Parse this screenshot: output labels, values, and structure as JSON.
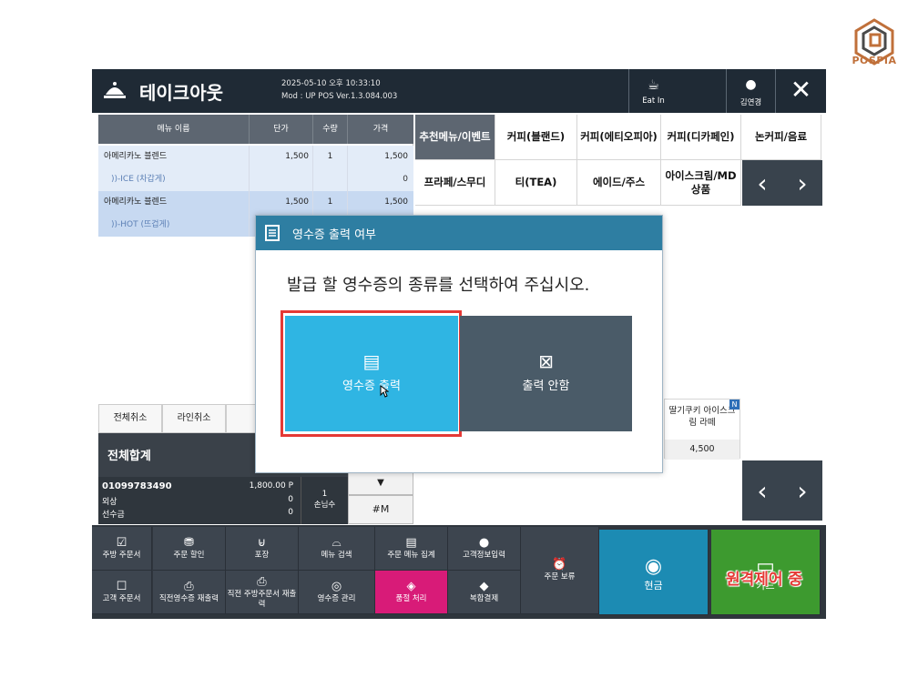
{
  "brand": {
    "name": "POSPIA"
  },
  "header": {
    "title": "테이크아웃",
    "datetime": "2025-05-10 오후 10:33:10",
    "mod": "Mod : UP POS Ver.1.3.084.003",
    "eat_in": "Eat In",
    "user": "김연경"
  },
  "order": {
    "columns": [
      "메뉴 이름",
      "단가",
      "수량",
      "가격"
    ],
    "rows": [
      {
        "name": "아메리카노 블렌드",
        "price": "1,500",
        "qty": "1",
        "total": "1,500"
      },
      {
        "name": "))-ICE (차갑게)",
        "price": "",
        "qty": "",
        "total": "0"
      },
      {
        "name": "아메리카노 블렌드",
        "price": "1,500",
        "qty": "1",
        "total": "1,500"
      },
      {
        "name": "))-HOT (뜨겁게)",
        "price": "",
        "qty": "",
        "total": ""
      }
    ],
    "cancel_all": "전체취소",
    "cancel_line": "라인취소",
    "total_label": "전체합계",
    "phone": "01099783490",
    "points": "1,800.00 P",
    "credit_label": "외상",
    "credit_value": "0",
    "prepaid_label": "선수금",
    "prepaid_value": "0",
    "guests_value": "1",
    "guests_label": "손님수",
    "hash_m": "#M"
  },
  "categories": [
    "추천메뉴/이벤트",
    "커피(블랜드)",
    "커피(에티오피아)",
    "커피(디카페인)",
    "논커피/음료",
    "프라페/스무디",
    "티(TEA)",
    "에이드/주스",
    "아이스크림/MD 상품"
  ],
  "product": {
    "name": "딸기쿠키 아이스크림 라떼",
    "price": "4,500",
    "badge": "N"
  },
  "modal": {
    "title": "영수증 출력 여부",
    "question": "발급 할 영수증의 종류를 선택하여 주십시오.",
    "print_label": "영수증 출력",
    "noprint_label": "출력 안함"
  },
  "footer": {
    "kitchen_order": "주방 주문서",
    "customer_order": "고객 주문서",
    "discount": "주문 할인",
    "reprint_receipt": "직전영수증 재출력",
    "packaging": "포장",
    "reprint_kitchen": "직전 주방주문서 재출력",
    "menu_search": "메뉴 검색",
    "receipt_manage": "영수증 관리",
    "menu_total": "주문 메뉴 집계",
    "soldout": "품절 처리",
    "customer_info": "고객정보입력",
    "combined_pay": "복합결제",
    "hold": "주문 보류",
    "cash": "현금",
    "card": "카드"
  },
  "overlay": {
    "remote": "원격제어 중"
  },
  "colors": {
    "primary_blue": "#2fb5e3",
    "modal_header": "#2e7ea2",
    "highlight_red": "#e53935",
    "cash_bg": "#1c8bb3",
    "card_bg": "#3d9a2f",
    "soldout_bg": "#d81b78"
  }
}
